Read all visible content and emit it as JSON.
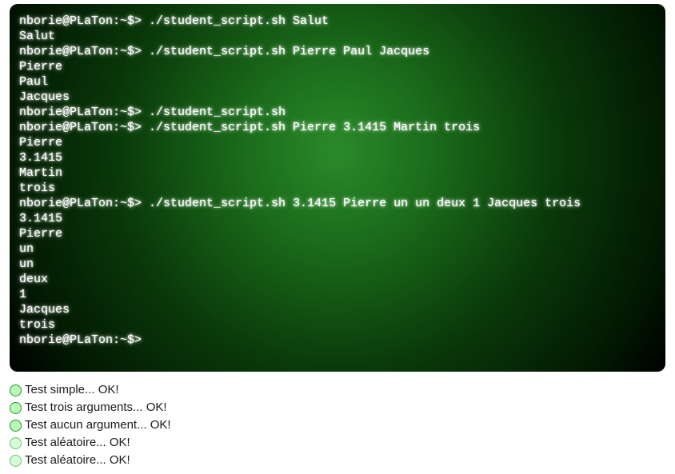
{
  "terminal": {
    "lines": [
      "nborie@PLaTon:~$> ./student_script.sh Salut",
      "Salut",
      "nborie@PLaTon:~$> ./student_script.sh Pierre Paul Jacques",
      "Pierre",
      "Paul",
      "Jacques",
      "nborie@PLaTon:~$> ./student_script.sh",
      "nborie@PLaTon:~$> ./student_script.sh Pierre 3.1415 Martin trois",
      "Pierre",
      "3.1415",
      "Martin",
      "trois",
      "nborie@PLaTon:~$> ./student_script.sh 3.1415 Pierre un un deux 1 Jacques trois",
      "3.1415",
      "Pierre",
      "un",
      "un",
      "deux",
      "1",
      "Jacques",
      "trois",
      "nborie@PLaTon:~$>"
    ]
  },
  "results": [
    {
      "label": "Test simple... OK!"
    },
    {
      "label": "Test trois arguments... OK!"
    },
    {
      "label": "Test aucun argument... OK!"
    },
    {
      "label": "Test aléatoire... OK!"
    },
    {
      "label": "Test aléatoire... OK!"
    }
  ]
}
